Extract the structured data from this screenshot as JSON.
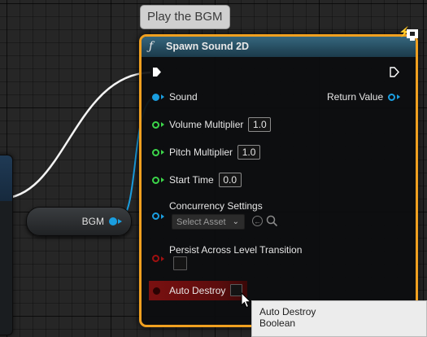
{
  "comment": "Play the BGM",
  "node": {
    "title": "Spawn Sound 2D",
    "header_color": "#2c5a70",
    "selection_border_color": "#f0a020",
    "pins": {
      "sound": "Sound",
      "return_value": "Return Value",
      "volume_multiplier": {
        "label": "Volume Multiplier",
        "value": "1.0"
      },
      "pitch_multiplier": {
        "label": "Pitch Multiplier",
        "value": "1.0"
      },
      "start_time": {
        "label": "Start Time",
        "value": "0.0"
      },
      "concurrency_settings": {
        "label": "Concurrency Settings",
        "select_placeholder": "Select Asset"
      },
      "persist_across_level_transition": {
        "label": "Persist Across Level Transition",
        "checked": false
      },
      "auto_destroy": {
        "label": "Auto Destroy",
        "checked": false
      }
    },
    "pin_colors": {
      "object": "#1a9ee0",
      "float": "#3cd64a",
      "bool": "#a01010"
    }
  },
  "variable_node": {
    "label": "BGM",
    "color": "#1a9ee0"
  },
  "tooltip": {
    "line1": "Auto Destroy",
    "line2": "Boolean"
  },
  "icons": [
    "function-icon",
    "exec-pin-icon",
    "world-context-icon",
    "search-icon",
    "use-selected-arrow-icon",
    "chevron-down-icon",
    "mouse-cursor-icon"
  ]
}
